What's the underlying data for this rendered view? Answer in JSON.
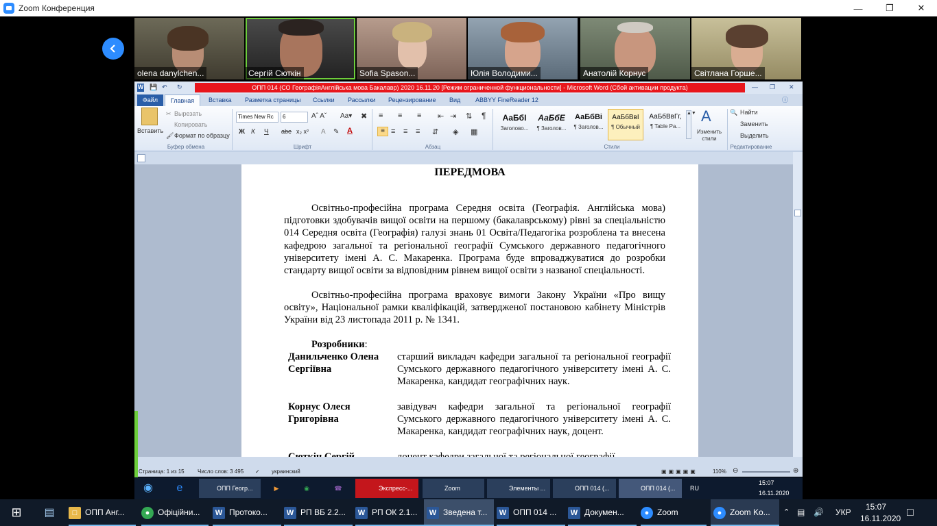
{
  "zoom": {
    "title": "Zoom Конференция",
    "participants": [
      {
        "name": "olena danylchen..."
      },
      {
        "name": "Сергій Сюткін"
      },
      {
        "name": "Sofia Spason..."
      },
      {
        "name": "Юлія Володими..."
      },
      {
        "name": "Анатолій Корнус"
      },
      {
        "name": "Світлана Горше..."
      }
    ]
  },
  "word": {
    "title": "ОПП 014 (СО ГеографіяАнглійська мова Бакалавр) 2020 16.11.20 [Режим ограниченной функциональности] - Microsoft Word (Сбой активации продукта)",
    "tabs": [
      "Файл",
      "Главная",
      "Вставка",
      "Разметка страницы",
      "Ссылки",
      "Рассылки",
      "Рецензирование",
      "Вид",
      "ABBYY FineReader 12"
    ],
    "clipboard": {
      "paste": "Вставить",
      "cut": "Вырезать",
      "copy": "Копировать",
      "format": "Формат по образцу",
      "group": "Буфер обмена"
    },
    "font": {
      "name": "Times New Rc",
      "size": "6",
      "group": "Шрифт"
    },
    "paragraph_group": "Абзац",
    "styles": [
      {
        "sample": "АаБбI",
        "label": "Заголово..."
      },
      {
        "sample": "АаБбЕ",
        "label": "¶ Заголов..."
      },
      {
        "sample": "АаБбВі",
        "label": "¶ Заголов..."
      },
      {
        "sample": "АаБбВвІ",
        "label": "¶ Обычный"
      },
      {
        "sample": "АаБбВвГг,",
        "label": "¶ Table Pa..."
      }
    ],
    "change_styles": "Изменить стили",
    "styles_group": "Стили",
    "editing": {
      "find": "Найти",
      "replace": "Заменить",
      "select": "Выделить",
      "group": "Редактирование"
    },
    "document": {
      "heading": "ПЕРЕДМОВА",
      "para1": "Освітньо-професійна програма Середня освіта (Географія. Англійська мова) підготовки здобувачів вищої освіти на першому (бакалаврському) рівні за спеціальністю 014 Середня освіта (Географія) галузі знань 01 Освіта/Педагогіка розроблена та внесена кафедрою загальної та регіональної географії Сумського державного педагогічного університету імені А. С. Макаренка. Програма буде впроваджуватися до розробки стандарту вищої освіти за відповідним рівнем вищої освіти з названої спеціальності.",
      "para2": "Освітньо-професійна програма враховує вимоги Закону України «Про вищу освіту», Національної рамки кваліфікацій, затвердженої постановою кабінету Міністрів України від 23 листопада 2011 р. № 1341.",
      "developers_label": "Розробники",
      "developers": [
        {
          "name": "Данильченко Олена Сергіївна",
          "desc": "старший викладач кафедри загальної та регіональної географії Сумського державного педагогічного університету імені А. С. Макаренка, кандидат географічних наук."
        },
        {
          "name": "Корнус Олеся Григорівна",
          "desc": "завідувач кафедри загальної та регіональної географії Сумського державного педагогічного університету імені А. С. Макаренка, кандидат географічних наук, доцент."
        },
        {
          "name": "Сюткін Сергій",
          "desc": "доцент кафедри загальної та регіональної географії"
        }
      ]
    },
    "status": {
      "page": "Страница: 1 из 15",
      "words": "Число слов: 3 495",
      "lang": "украинский",
      "zoom": "110%"
    }
  },
  "shared_taskbar": {
    "items": [
      "ОПП Геогр...",
      "Экспресс-...",
      "Zoom",
      "Элементы ...",
      "ОПП 014 (...",
      "ОПП 014 (..."
    ],
    "lang": "RU",
    "time": "15:07",
    "date": "16.11.2020"
  },
  "taskbar": {
    "items": [
      "ОПП Анг...",
      "Офіційни...",
      "Протоко...",
      "РП ВБ 2.2...",
      "РП ОК 2.1...",
      "Зведена т...",
      "ОПП 014 ...",
      "Докумен...",
      "Zoom",
      "Zoom Ko..."
    ],
    "lang": "УКР",
    "time": "15:07",
    "date": "16.11.2020"
  }
}
